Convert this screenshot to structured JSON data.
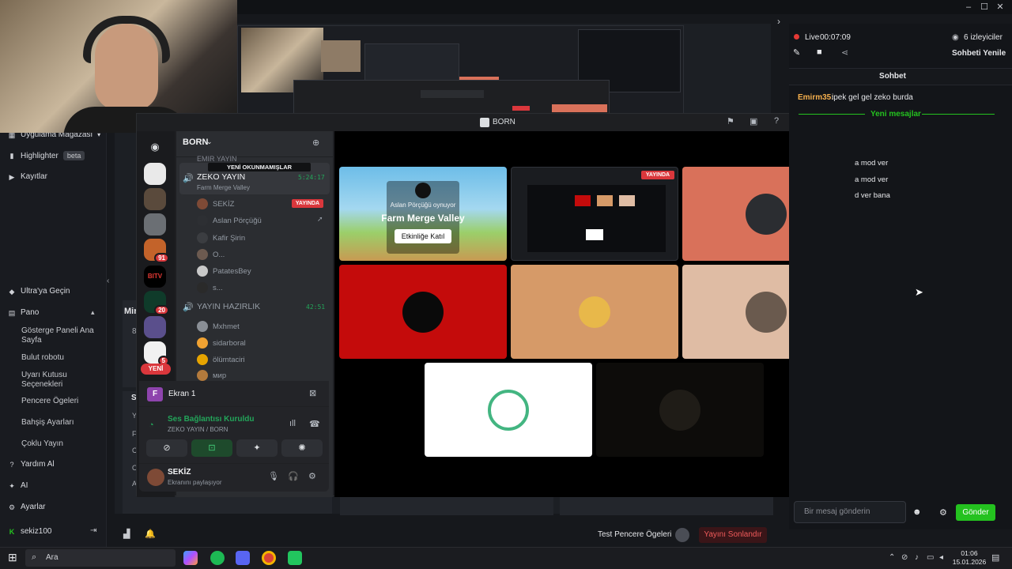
{
  "stream_app": {
    "live_label": "Live",
    "live_time": "00:07:09",
    "viewers": "6 izleyiciler",
    "refresh_chat": "Sohbeti Yenile",
    "chat_title": "Sohbet",
    "chat_user": "Emirm35:",
    "chat_msg": "ipek gel gel zeko burda",
    "new_messages": "Yeni mesajlar",
    "msg1": "a mod ver",
    "msg2": "a mod ver",
    "msg3": "d ver bana",
    "chat_placeholder": "Bir mesaj gönderin",
    "send_label": "Gönder",
    "test_window_items": "Test Pencere Ögeleri",
    "end_stream": "Yayını Sonlandır",
    "sidebar": {
      "store": "Uygulama Mağazası",
      "highlighter": "Highlighter",
      "beta": "beta",
      "records": "Kayıtlar",
      "ultra": "Ultra'ya Geçin",
      "dashboard": "Pano",
      "dash_home": "Gösterge Paneli Ana Sayfa",
      "cloud_bot": "Bulut robotu",
      "alert_box": "Uyarı Kutusu Seçenekleri",
      "window_items": "Pencere Ögeleri",
      "donation": "Bahşiş Ayarları",
      "multistream": "Çoklu Yayın",
      "help": "Yardım Al",
      "ai": "AI",
      "settings": "Ayarlar",
      "user": "sekiz100"
    },
    "mid_fragment_1": "Mir",
    "mid_fragment_2": "8",
    "mid_letters": [
      "S",
      "Y",
      "F",
      "C",
      "O",
      "A"
    ]
  },
  "discord": {
    "window_title": "BORN",
    "server_name": "BORN",
    "unread_banner": "YENİ OKUNMAMIŞLAR",
    "channel_top": "EMIR YAYIN",
    "channel1": {
      "name": "ZEKO YAYIN",
      "activity": "Farm Merge Valley",
      "timer": "5:24:17"
    },
    "channel1_users": [
      "SEKİZ",
      "Aslan Pörçüğü",
      "Kafir Şirin",
      "O...",
      "PatatesBey",
      "s..."
    ],
    "live_badge": "YAYINDA",
    "channel2": {
      "name": "YAYIN HAZIRLIK",
      "timer": "42:51"
    },
    "channel2_users": [
      "Mxhmet",
      "sidarboral",
      "ölümtaciri",
      "мир"
    ],
    "server_badges": [
      "91",
      "20",
      "5"
    ],
    "new_label": "YENİ",
    "screen_label": "Ekran 1",
    "voice_status": "Ses Bağlantısı Kuruldu",
    "voice_channel": "ZEKO YAYIN / BORN",
    "user_name": "SEKİZ",
    "user_status": "Ekranını paylaşıyor",
    "activity_tile": {
      "host": "Aslan Pörçüğü oynuyor",
      "game": "Farm Merge Valley",
      "join": "Etkinliğe Katıl"
    },
    "stream_tile_badge": "YAYINDA"
  },
  "taskbar": {
    "search": "Ara",
    "time": "01:06",
    "date": "15.01.2026"
  },
  "colors": {
    "accent_green": "#24c21f",
    "discord_green": "#23a55a",
    "live_red": "#da373c",
    "tile_salmon": "#d9715a",
    "tile_red": "#c40b0b",
    "tile_orange": "#d69a68",
    "tile_beige": "#dfbca4"
  }
}
